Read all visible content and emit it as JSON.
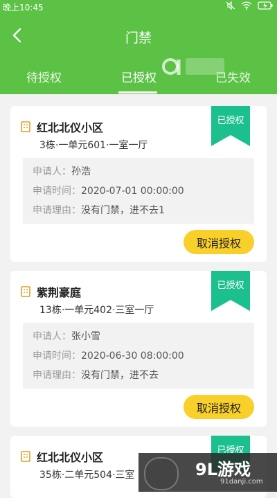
{
  "status_bar": {
    "time": "晚上10:45"
  },
  "header": {
    "title": "门禁"
  },
  "tabs": [
    {
      "label": "待授权"
    },
    {
      "label": "已授权",
      "active": true
    },
    {
      "label": "已失效"
    }
  ],
  "watermark": {
    "logo_text": "9L游戏",
    "url": "91danji.com"
  },
  "labels": {
    "applicant": "申请人：",
    "apply_time": "申请时间：",
    "reason": "申请理由：",
    "badge": "已授权",
    "cancel": "取消授权"
  },
  "cards": [
    {
      "community": "红北北仪小区",
      "address": "3栋·一单元601·一室一厅",
      "applicant": "孙浩",
      "apply_time": "2020-07-01 00:00:00",
      "reason": "没有门禁，进不去1"
    },
    {
      "community": "紫荆豪庭",
      "address": "13栋·一单元402·三室一厅",
      "applicant": "张小雪",
      "apply_time": "2020-06-30 08:00:00",
      "reason": "没有门禁，进不去"
    },
    {
      "community": "红北北仪小区",
      "address": "35栋·二单元504·三室"
    }
  ],
  "colors": {
    "brand_green": "#5cc246",
    "badge_green": "#1cc08e",
    "button_yellow": "#f9cf2a"
  }
}
